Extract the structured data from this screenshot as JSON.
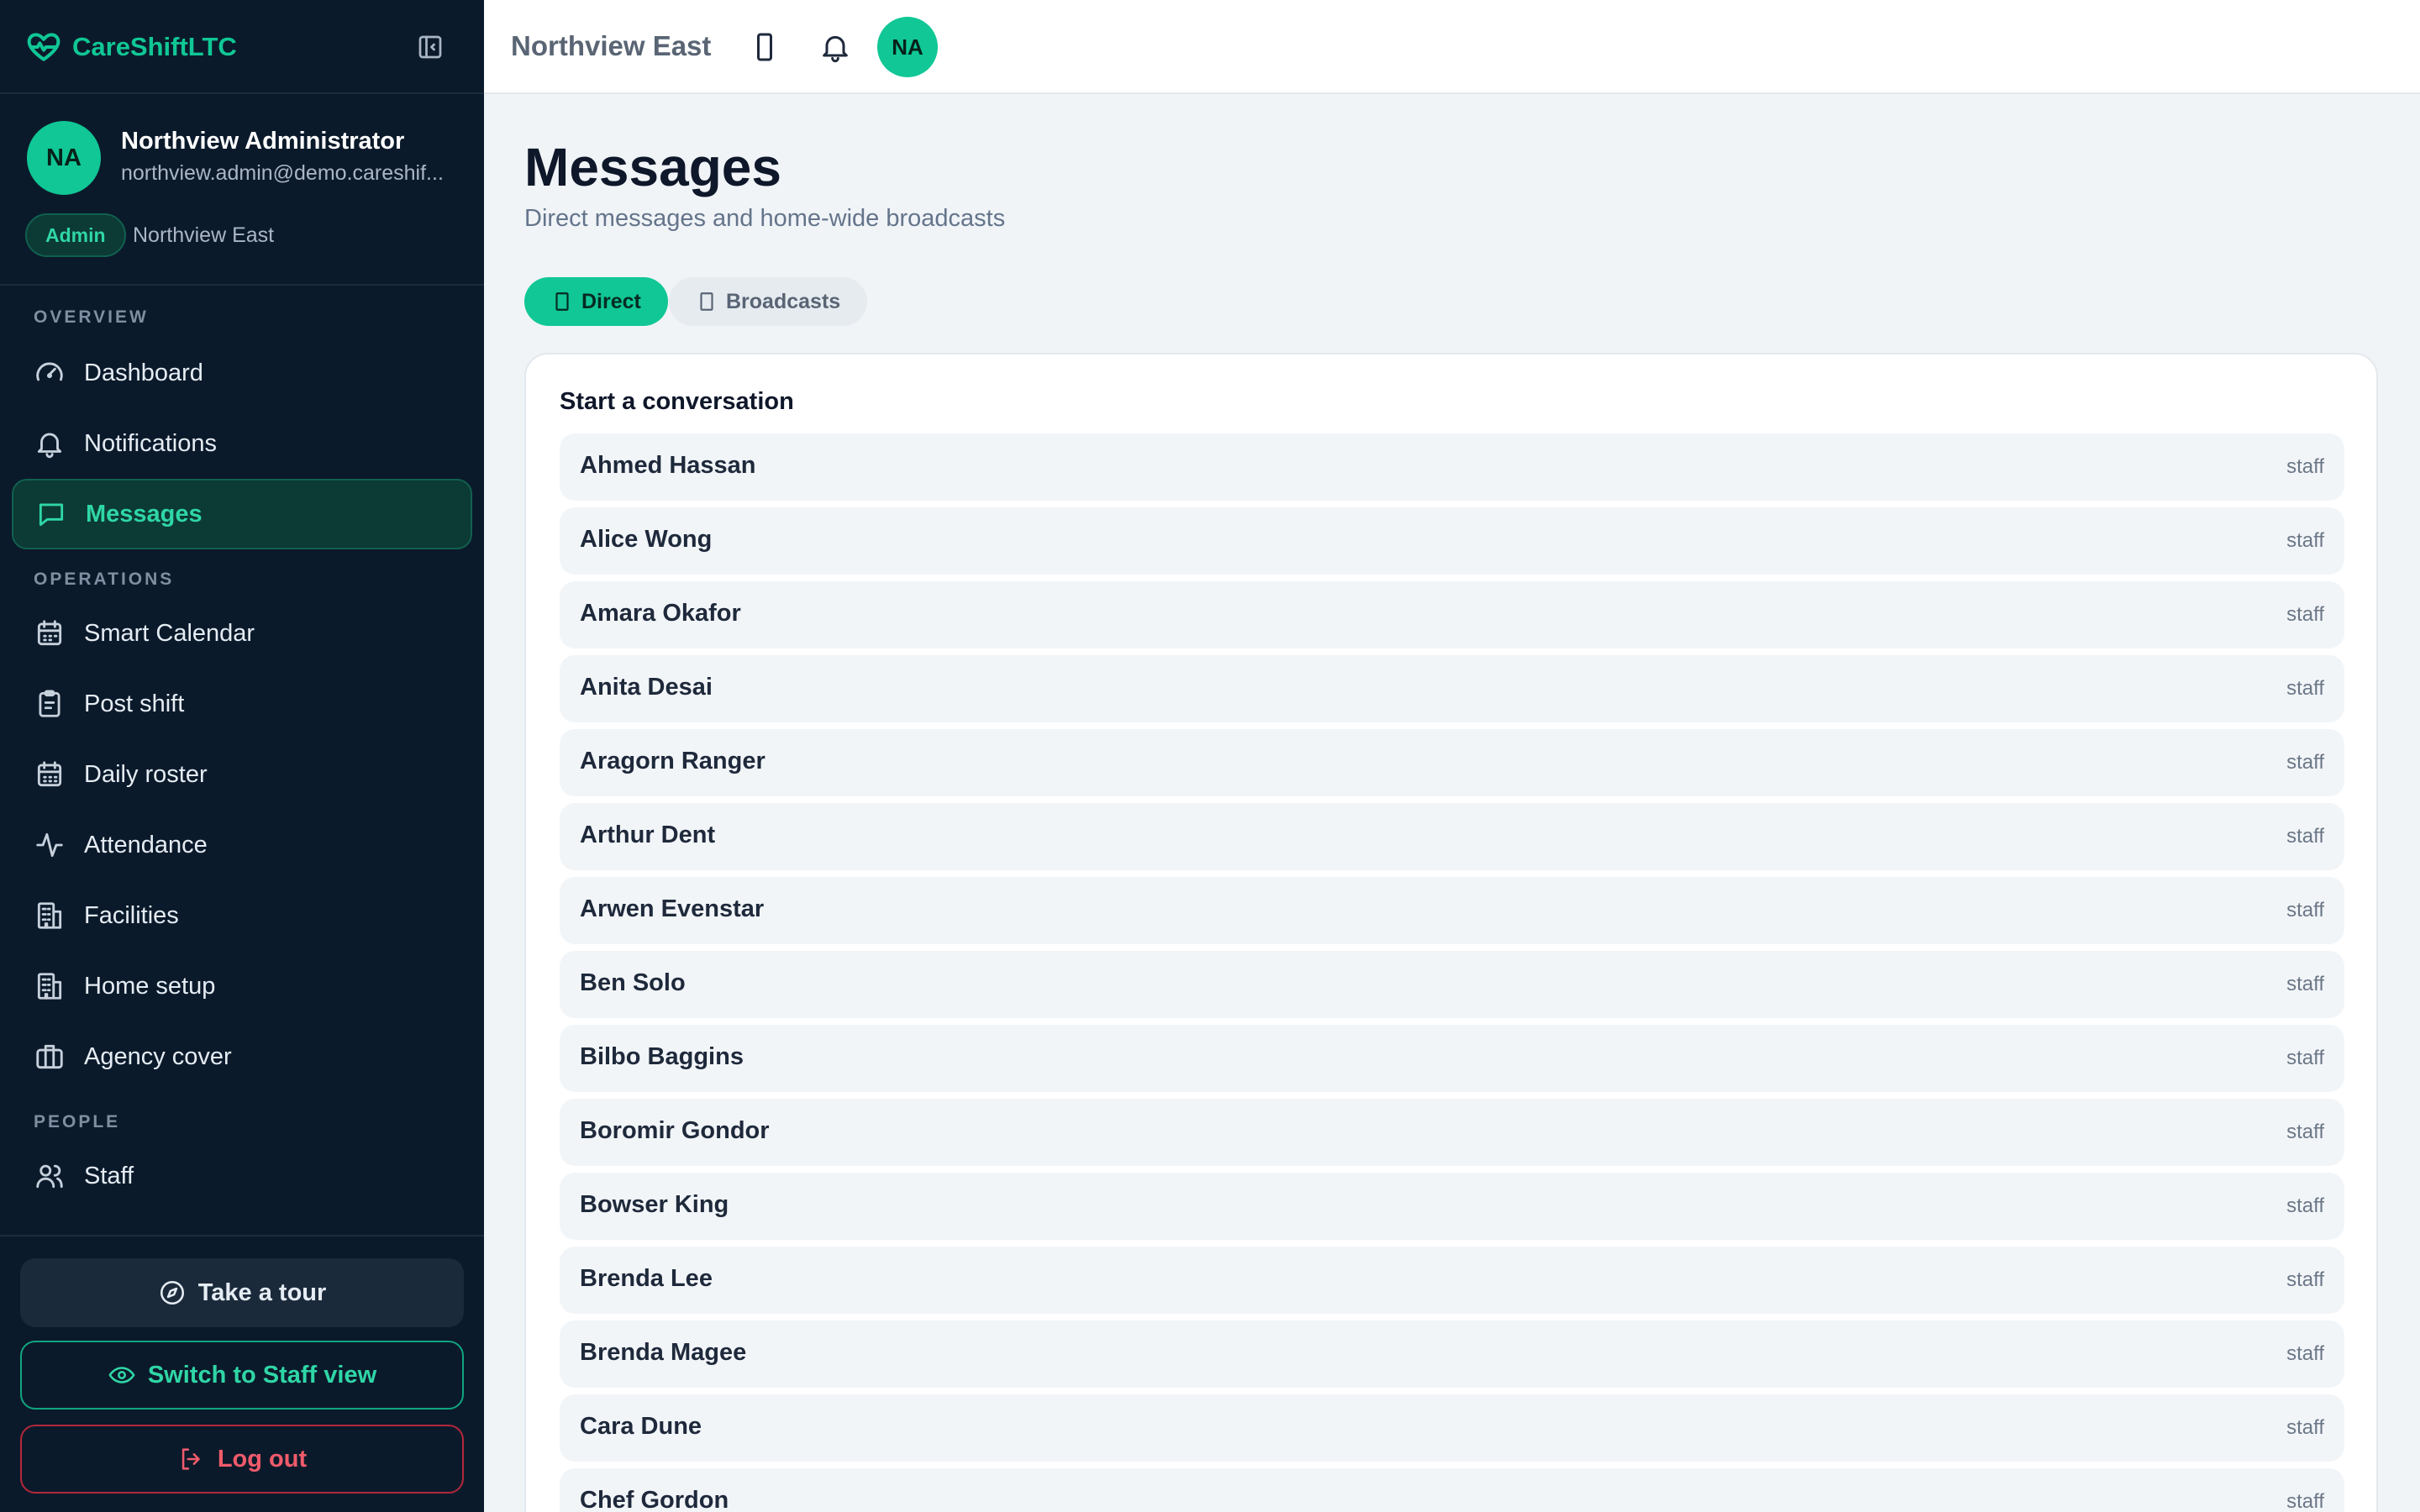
{
  "brand": {
    "name": "CareShiftLTC"
  },
  "profile": {
    "initials": "NA",
    "name": "Northview Administrator",
    "email": "northview.admin@demo.careshif...",
    "role": "Admin",
    "home": "Northview East"
  },
  "nav": {
    "sections": [
      "OVERVIEW",
      "OPERATIONS",
      "PEOPLE"
    ],
    "items": [
      {
        "label": "Dashboard",
        "icon": "gauge-icon"
      },
      {
        "label": "Notifications",
        "icon": "bell-icon"
      },
      {
        "label": "Messages",
        "icon": "message-icon",
        "active": true
      },
      {
        "label": "Smart Calendar",
        "icon": "calendar-icon"
      },
      {
        "label": "Post shift",
        "icon": "clipboard-icon"
      },
      {
        "label": "Daily roster",
        "icon": "calendar-grid-icon"
      },
      {
        "label": "Attendance",
        "icon": "activity-icon"
      },
      {
        "label": "Facilities",
        "icon": "building-icon"
      },
      {
        "label": "Home setup",
        "icon": "building-icon"
      },
      {
        "label": "Agency cover",
        "icon": "briefcase-icon"
      },
      {
        "label": "Staff",
        "icon": "users-icon"
      }
    ]
  },
  "footer": {
    "tour": "Take a tour",
    "switch": "Switch to Staff view",
    "logout": "Log out"
  },
  "topbar": {
    "title": "Northview East",
    "avatar": "NA"
  },
  "page": {
    "title": "Messages",
    "subtitle": "Direct messages and home-wide broadcasts",
    "tabs": {
      "direct": "Direct",
      "broadcasts": "Broadcasts"
    }
  },
  "conversation": {
    "title": "Start a conversation",
    "contacts": [
      {
        "name": "Ahmed Hassan",
        "role": "staff"
      },
      {
        "name": "Alice Wong",
        "role": "staff"
      },
      {
        "name": "Amara Okafor",
        "role": "staff"
      },
      {
        "name": "Anita Desai",
        "role": "staff"
      },
      {
        "name": "Aragorn Ranger",
        "role": "staff"
      },
      {
        "name": "Arthur Dent",
        "role": "staff"
      },
      {
        "name": "Arwen Evenstar",
        "role": "staff"
      },
      {
        "name": "Ben Solo",
        "role": "staff"
      },
      {
        "name": "Bilbo Baggins",
        "role": "staff"
      },
      {
        "name": "Boromir Gondor",
        "role": "staff"
      },
      {
        "name": "Bowser King",
        "role": "staff"
      },
      {
        "name": "Brenda Lee",
        "role": "staff"
      },
      {
        "name": "Brenda Magee",
        "role": "staff"
      },
      {
        "name": "Cara Dune",
        "role": "staff"
      },
      {
        "name": "Chef Gordon",
        "role": "staff"
      }
    ]
  },
  "colors": {
    "accent": "#10c795",
    "sidebar_bg": "#0b1a2b",
    "danger": "#f05b6b"
  }
}
